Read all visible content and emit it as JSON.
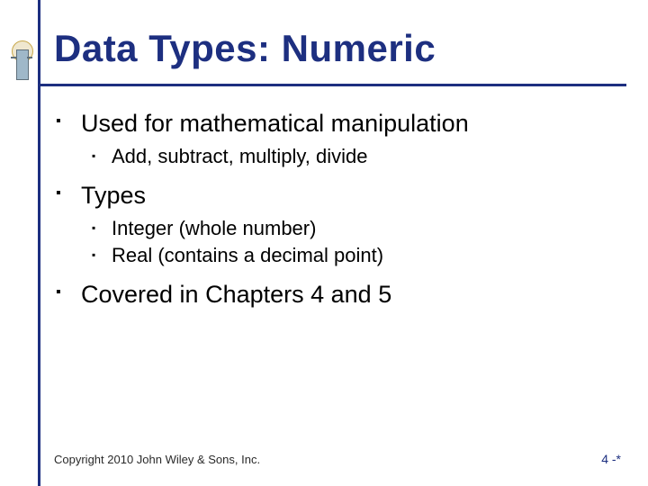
{
  "title": "Data Types: Numeric",
  "content": {
    "items": [
      {
        "text": "Used for mathematical manipulation",
        "sub": [
          {
            "text": "Add, subtract, multiply, divide"
          }
        ]
      },
      {
        "text": "Types",
        "sub": [
          {
            "text": "Integer (whole number)"
          },
          {
            "text": "Real (contains a decimal point)"
          }
        ]
      },
      {
        "text": "Covered in Chapters 4 and 5",
        "sub": []
      }
    ]
  },
  "footer": {
    "copyright": "Copyright 2010 John Wiley & Sons, Inc.",
    "page": "4 -*"
  },
  "bullets": {
    "level1": "▪",
    "level2": "▪"
  }
}
